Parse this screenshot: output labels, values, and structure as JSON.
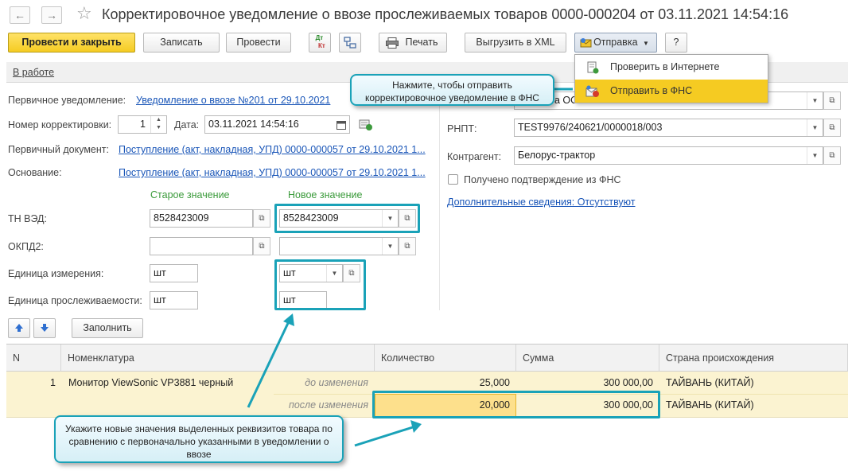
{
  "window": {
    "title": "Корректировочное уведомление о ввозе прослеживаемых товаров 0000-000204 от 03.11.2021 14:54:16",
    "back_glyph": "←",
    "forward_glyph": "→",
    "star_glyph": "☆"
  },
  "toolbar": {
    "post_and_close": "Провести и закрыть",
    "save": "Записать",
    "post": "Провести",
    "dtkt_top": "Дт",
    "dtkt_bottom": "Кт",
    "print": "Печать",
    "export_xml": "Выгрузить в XML",
    "send": "Отправка",
    "help": "?"
  },
  "send_menu": {
    "items": [
      "Проверить в Интернете",
      "Отправить в ФНС"
    ],
    "selected": "Отправить в ФНС"
  },
  "status": "В работе",
  "form": {
    "primary_notice_label": "Первичное уведомление:",
    "primary_notice_link": "Уведомление о ввозе №201 от 29.10.2021",
    "correction_number_label": "Номер корректировки:",
    "correction_number": "1",
    "date_label": "Дата:",
    "date": "03.11.2021 14:54:16",
    "primary_doc_label": "Первичный документ:",
    "primary_doc_link": "Поступление (акт, накладная, УПД) 0000-000057 от 29.10.2021 1...",
    "basis_label": "Основание:",
    "basis_link": "Поступление (акт, накладная, УПД) 0000-000057 от 29.10.2021 1...",
    "old_value_header": "Старое значение",
    "new_value_header": "Новое значение",
    "tnved_label": "ТН ВЭД:",
    "tnved_old": "8528423009",
    "tnved_new": "8528423009",
    "okpd2_label": "ОКПД2:",
    "okpd2_old": "",
    "okpd2_new": "",
    "unit_label": "Единица измерения:",
    "unit_old": "шт",
    "unit_new": "шт",
    "trace_unit_label": "Единица прослеживаемости:",
    "trace_unit_old": "шт",
    "trace_unit_new": "шт",
    "fill_button": "Заполнить"
  },
  "right": {
    "org_value_fragment": "а ООО",
    "rnpt_label": "РНПТ:",
    "rnpt": "TEST9976/240621/0000018/003",
    "counterparty_label": "Контрагент:",
    "counterparty": "Белорус-трактор",
    "fns_confirm_label": "Получено подтверждение из ФНС",
    "additional_info_link": "Дополнительные сведения: Отсутствуют"
  },
  "table": {
    "columns": [
      "N",
      "Номенклатура",
      "Количество",
      "Сумма",
      "Страна происхождения"
    ],
    "rows": [
      {
        "n": "1",
        "item": "Монитор ViewSonic VP3881 черный",
        "before_label": "до изменения",
        "before_qty": "25,000",
        "before_sum": "300 000,00",
        "before_country": "ТАЙВАНЬ (КИТАЙ)",
        "after_label": "после изменения",
        "after_qty": "20,000",
        "after_sum": "300 000,00",
        "after_country": "ТАЙВАНЬ (КИТАЙ)"
      }
    ]
  },
  "callouts": {
    "send_hint": "Нажмите, чтобы отправить корректировочное уведомление в ФНС",
    "values_hint": "Укажите новые значения выделенных реквизитов товара по сравнению с первоначально указанными в уведомлении о ввозе"
  },
  "colors": {
    "accent_yellow": "#f5cb22",
    "highlight_teal": "#1aa2b8",
    "link_blue": "#1a56b8"
  }
}
